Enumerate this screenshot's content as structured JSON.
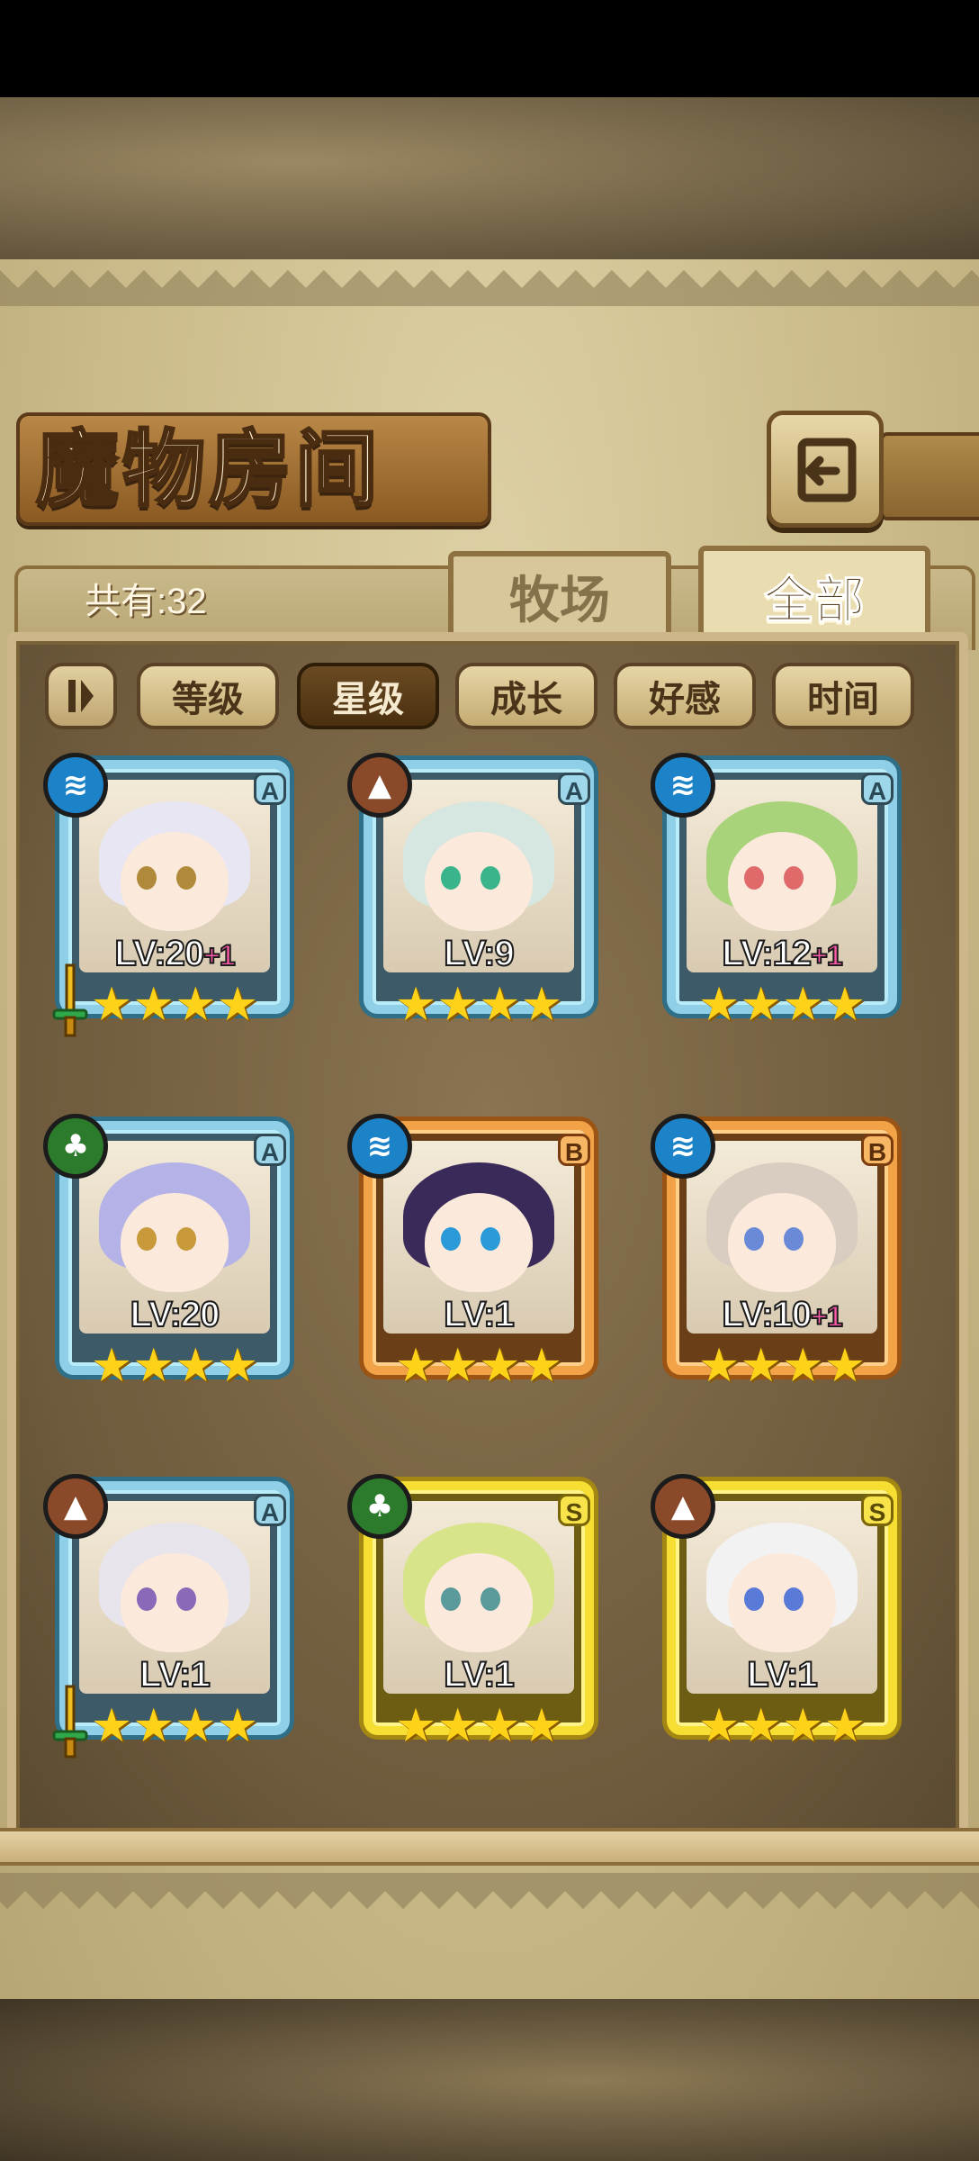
{
  "header": {
    "title": "魔物房间",
    "back_icon": "return-arrow-icon"
  },
  "tabs": {
    "count_label": "共有:32",
    "farm": "牧场",
    "all": "全部"
  },
  "sort": {
    "toggle_icon": "sort-order-icon",
    "buttons": [
      {
        "label": "等级",
        "active": false
      },
      {
        "label": "星级",
        "active": true
      },
      {
        "label": "成长",
        "active": false
      },
      {
        "label": "好感",
        "active": false
      },
      {
        "label": "时间",
        "active": false
      }
    ]
  },
  "colors": {
    "water": "#1c83c8",
    "earth": "#8a4a2a",
    "wood": "#2c7a2c",
    "frame_blue": "#8fd0e8",
    "frame_orange": "#f2a348",
    "frame_gold": "#f6de32",
    "star": "#ffd21a",
    "plus_pink": "#ff5aa8"
  },
  "monsters": [
    {
      "element": "water-icon",
      "rank": "A",
      "frame": "blue",
      "level": "LV:20",
      "plus": "+1",
      "stars": 4,
      "weapon": true
    },
    {
      "element": "earth-icon",
      "rank": "A",
      "frame": "blue",
      "level": "LV:9",
      "plus": "",
      "stars": 4,
      "weapon": false
    },
    {
      "element": "water-icon",
      "rank": "A",
      "frame": "blue",
      "level": "LV:12",
      "plus": "+1",
      "stars": 4,
      "weapon": false
    },
    {
      "element": "wood-icon",
      "rank": "A",
      "frame": "blue",
      "level": "LV:20",
      "plus": "",
      "stars": 4,
      "weapon": false
    },
    {
      "element": "water-icon",
      "rank": "B",
      "frame": "orange",
      "level": "LV:1",
      "plus": "",
      "stars": 4,
      "weapon": false
    },
    {
      "element": "water-icon",
      "rank": "B",
      "frame": "orange",
      "level": "LV:10",
      "plus": "+1",
      "stars": 4,
      "weapon": false
    },
    {
      "element": "earth-icon",
      "rank": "A",
      "frame": "blue",
      "level": "LV:1",
      "plus": "",
      "stars": 4,
      "weapon": true
    },
    {
      "element": "wood-icon",
      "rank": "S",
      "frame": "gold",
      "level": "LV:1",
      "plus": "",
      "stars": 4,
      "weapon": false
    },
    {
      "element": "earth-icon",
      "rank": "S",
      "frame": "gold",
      "level": "LV:1",
      "plus": "",
      "stars": 4,
      "weapon": false
    }
  ]
}
